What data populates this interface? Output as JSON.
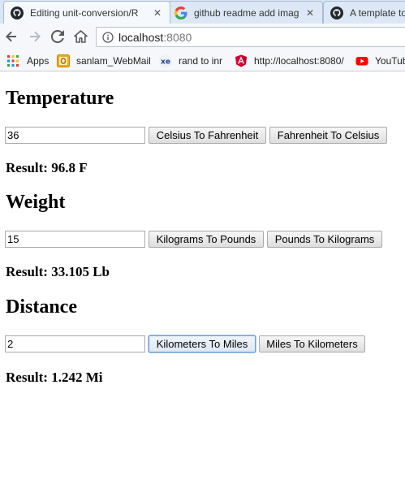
{
  "tabs": [
    {
      "title": "Editing unit-conversion/R",
      "close": "✕",
      "icon": "github-icon"
    },
    {
      "title": "github readme add imag",
      "close": "✕",
      "icon": "google-icon"
    },
    {
      "title": "A template to",
      "icon": "github-icon"
    }
  ],
  "address_bar": {
    "host": "localhost",
    "port": ":8080"
  },
  "bookmarks": [
    {
      "label": "Apps",
      "icon": "apps-grid-icon"
    },
    {
      "label": "sanlam_WebMail",
      "icon": "outlook-icon"
    },
    {
      "label": "rand to inr",
      "icon": "xe-icon"
    },
    {
      "label": "http://localhost:8080/",
      "icon": "angular-icon"
    },
    {
      "label": "YouTub",
      "icon": "youtube-icon"
    }
  ],
  "sections": {
    "temperature": {
      "heading": "Temperature",
      "input_value": "36",
      "button_1": "Celsius To Fahrenheit",
      "button_2": "Fahrenheit To Celsius",
      "result": "Result: 96.8 F"
    },
    "weight": {
      "heading": "Weight",
      "input_value": "15",
      "button_1": "Kilograms To Pounds",
      "button_2": "Pounds To Kilograms",
      "result": "Result: 33.105 Lb"
    },
    "distance": {
      "heading": "Distance",
      "input_value": "2",
      "button_1": "Kilometers To Miles",
      "button_2": "Miles To Kilometers",
      "result": "Result: 1.242 Mi"
    }
  },
  "colors": {
    "tab_strip": "#dbe6f5",
    "toolbar": "#f5f7fa",
    "focus_ring": "#6e9fd6"
  }
}
